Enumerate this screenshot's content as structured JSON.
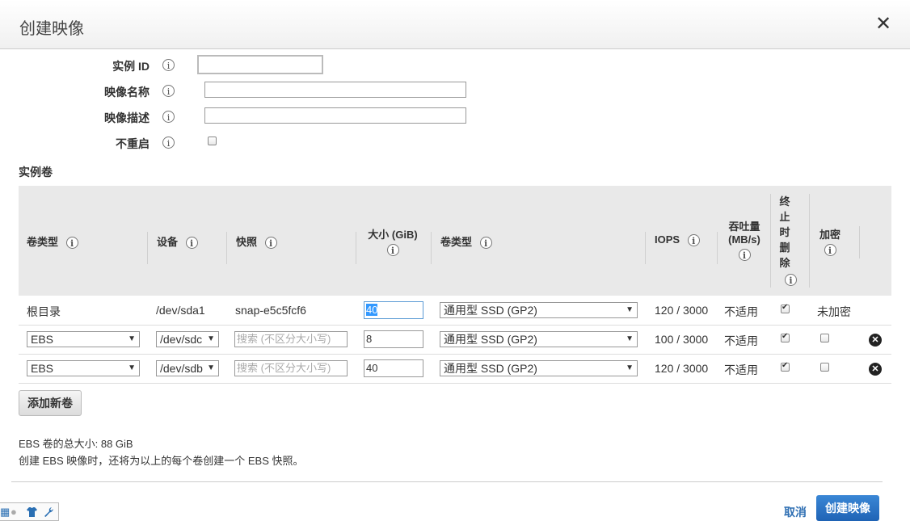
{
  "dialog": {
    "title": "创建映像",
    "close_icon": "✕"
  },
  "form": {
    "instance_id_label": "实例 ID",
    "image_name_label": "映像名称",
    "image_desc_label": "映像描述",
    "no_reboot_label": "不重启",
    "info_glyph": "i",
    "instance_id_value": "",
    "image_name_value": "",
    "image_desc_value": ""
  },
  "volumes": {
    "section_title": "实例卷",
    "headers": {
      "volume_type": "卷类型",
      "device": "设备",
      "snapshot": "快照",
      "size": "大小 (GiB)",
      "volume_kind": "卷类型",
      "iops": "IOPS",
      "throughput_line1": "吞吐量",
      "throughput_line2": "(MB/s)",
      "delete_on_term": [
        "终",
        "止",
        "时",
        "删",
        "除"
      ],
      "encrypted": "加密"
    },
    "rows": [
      {
        "type": "根目录",
        "device": "/dev/sda1",
        "snapshot": "snap-e5c5fcf6",
        "size": "40",
        "kind": "通用型 SSD (GP2)",
        "iops": "120 / 3000",
        "throughput": "不适用",
        "delete_on_term": true,
        "encrypted": "未加密"
      },
      {
        "type": "EBS",
        "device": "/dev/sdc",
        "snapshot_placeholder": "搜索 (不区分大小写)",
        "size": "8",
        "kind": "通用型 SSD (GP2)",
        "iops": "100 / 3000",
        "throughput": "不适用",
        "delete_on_term": true,
        "encrypted": false
      },
      {
        "type": "EBS",
        "device": "/dev/sdb",
        "snapshot_placeholder": "搜索 (不区分大小写)",
        "size": "40",
        "kind": "通用型 SSD (GP2)",
        "iops": "120 / 3000",
        "throughput": "不适用",
        "delete_on_term": true,
        "encrypted": false
      }
    ],
    "add_button": "添加新卷",
    "dropdown_arrow": "▼",
    "remove_glyph": "✕"
  },
  "summary": {
    "total_size": "EBS 卷的总大小: 88 GiB",
    "note": "创建 EBS 映像时，还将为以上的每个卷创建一个 EBS 快照。"
  },
  "footer": {
    "cancel": "取消",
    "create": "创建映像"
  },
  "taskbar": {
    "icons": [
      "grid-icon",
      "user-icon",
      "shirt-icon",
      "wrench-icon"
    ]
  },
  "colors": {
    "link": "#2f6fb3",
    "primary_button": "#1f63b5",
    "header_bg": "#e9e9e9"
  }
}
